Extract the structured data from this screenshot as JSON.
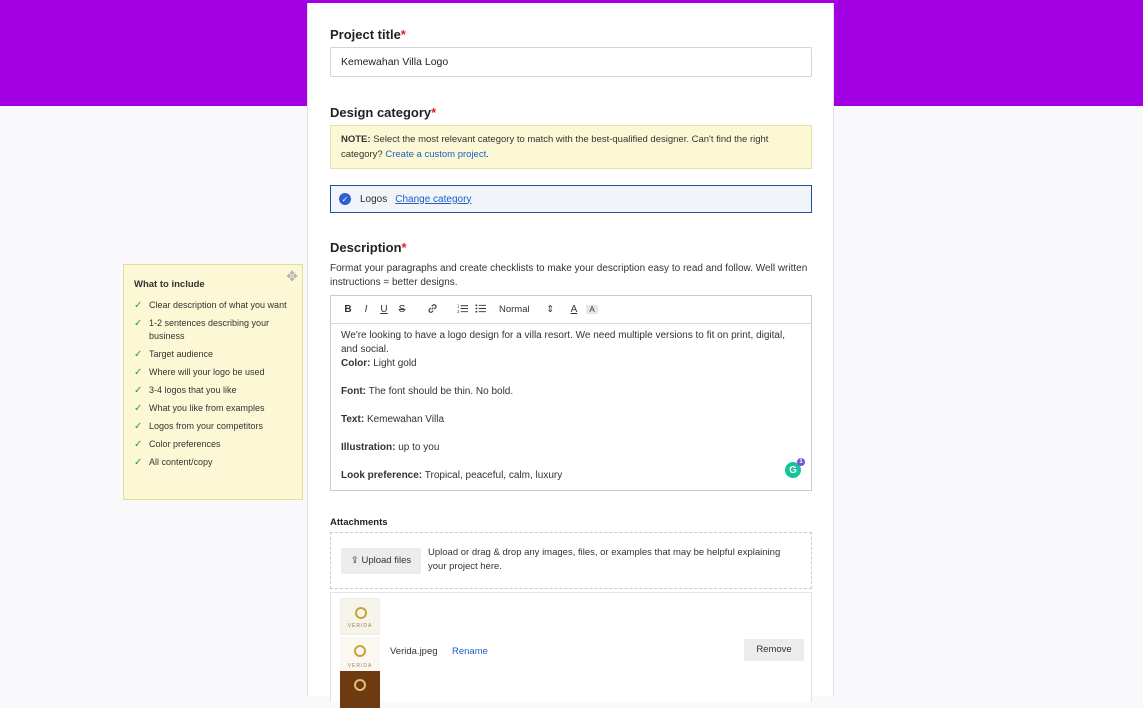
{
  "colors": {
    "header_band": "#a200e2",
    "accent_link": "#1b5fc7",
    "required": "#e11d2a"
  },
  "project_title": {
    "label": "Project title",
    "required_mark": "*",
    "value": "Kemewahan Villa Logo"
  },
  "design_category": {
    "label": "Design category",
    "required_mark": "*",
    "note_prefix": "NOTE:",
    "note_text": "Select the most relevant category to match with the best-qualified designer. Can't find the right category?",
    "note_link": "Create a custom project",
    "note_suffix": ".",
    "selected": "Logos",
    "change_link": "Change category"
  },
  "description": {
    "label": "Description",
    "required_mark": "*",
    "help": "Format your paragraphs and create checklists to make your description easy to read and follow. Well written instructions = better designs.",
    "toolbar": {
      "bold": "B",
      "italic": "I",
      "underline": "U",
      "strike": "S",
      "link_icon": "link-icon",
      "ordered_list_icon": "ordered-list-icon",
      "bullet_list_icon": "bullet-list-icon",
      "format_value": "Normal",
      "format_caret": "⇕",
      "font_color": "A",
      "highlight": "A"
    },
    "intro": "We're looking to have a logo design for a villa resort. We need multiple versions to fit on print, digital, and social.",
    "color_label": "Color:",
    "color_value": "Light gold",
    "font_label": "Font:",
    "font_value": "The font should be thin. No bold.",
    "text_label": "Text:",
    "text_value": "Kemewahan Villa",
    "illustration_label": "Illustration:",
    "illustration_value": "up to you",
    "look_label": "Look preference:",
    "look_value": "Tropical, peaceful, calm, luxury",
    "grammarly_letter": "G",
    "grammarly_count": "1"
  },
  "attachments": {
    "label": "Attachments",
    "upload_button": "Upload files",
    "upload_help": "Upload or drag & drop any images, files, or examples that may be helpful explaining your project here.",
    "file": {
      "name": "Verida.jpeg",
      "rename": "Rename",
      "remove": "Remove",
      "thumb_text": "VERIDA"
    }
  },
  "sidebar_tips": {
    "title": "What to include",
    "items": [
      "Clear description of what you want",
      "1-2 sentences describing your business",
      "Target audience",
      "Where will your logo be used",
      "3-4 logos that you like",
      "What you like from examples",
      "Logos from your competitors",
      "Color preferences",
      "All content/copy"
    ]
  }
}
